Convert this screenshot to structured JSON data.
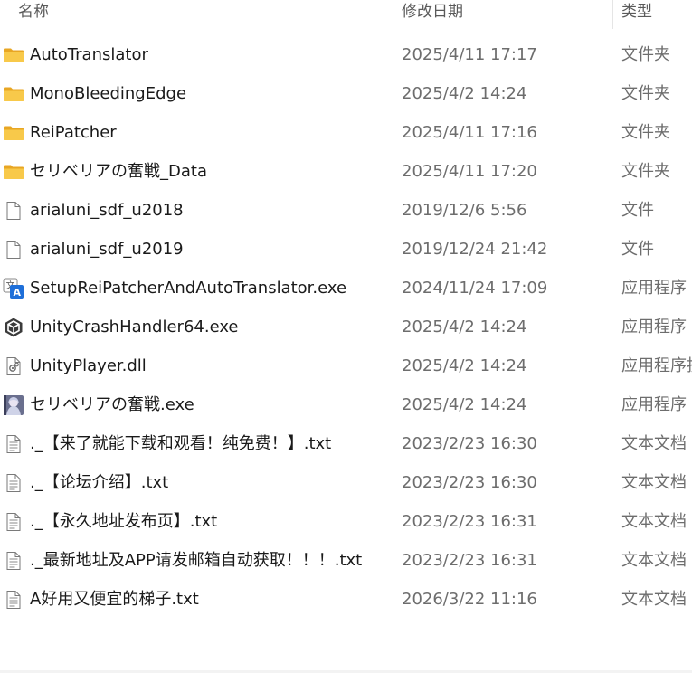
{
  "columns": {
    "name": "名称",
    "date": "修改日期",
    "type": "类型"
  },
  "files": [
    {
      "name": "AutoTranslator",
      "date": "2025/4/11 17:17",
      "type": "文件夹",
      "icon": "folder-icon"
    },
    {
      "name": "MonoBleedingEdge",
      "date": "2025/4/2 14:24",
      "type": "文件夹",
      "icon": "folder-icon"
    },
    {
      "name": "ReiPatcher",
      "date": "2025/4/11 17:16",
      "type": "文件夹",
      "icon": "folder-icon"
    },
    {
      "name": "セリベリアの奮戦_Data",
      "date": "2025/4/11 17:20",
      "type": "文件夹",
      "icon": "folder-icon"
    },
    {
      "name": "arialuni_sdf_u2018",
      "date": "2019/12/6 5:56",
      "type": "文件",
      "icon": "blank-file-icon"
    },
    {
      "name": "arialuni_sdf_u2019",
      "date": "2019/12/24 21:42",
      "type": "文件",
      "icon": "blank-file-icon"
    },
    {
      "name": "SetupReiPatcherAndAutoTranslator.exe",
      "date": "2024/11/24 17:09",
      "type": "应用程序",
      "icon": "translator-app-icon"
    },
    {
      "name": "UnityCrashHandler64.exe",
      "date": "2025/4/2 14:24",
      "type": "应用程序",
      "icon": "unity-icon"
    },
    {
      "name": "UnityPlayer.dll",
      "date": "2025/4/2 14:24",
      "type": "应用程序扩",
      "icon": "dll-file-icon"
    },
    {
      "name": "セリベリアの奮戦.exe",
      "date": "2025/4/2 14:24",
      "type": "应用程序",
      "icon": "game-app-icon"
    },
    {
      "name": "._【来了就能下载和观看！纯免费！】.txt",
      "date": "2023/2/23 16:30",
      "type": "文本文档",
      "icon": "text-file-icon"
    },
    {
      "name": "._【论坛介绍】.txt",
      "date": "2023/2/23 16:30",
      "type": "文本文档",
      "icon": "text-file-icon"
    },
    {
      "name": "._【永久地址发布页】.txt",
      "date": "2023/2/23 16:31",
      "type": "文本文档",
      "icon": "text-file-icon"
    },
    {
      "name": "._最新地址及APP请发邮箱自动获取！！！.txt",
      "date": "2023/2/23 16:31",
      "type": "文本文档",
      "icon": "text-file-icon"
    },
    {
      "name": "A好用又便宜的梯子.txt",
      "date": "2026/3/22 11:16",
      "type": "文本文档",
      "icon": "text-file-icon"
    }
  ],
  "colors": {
    "folder": "#f8c94a",
    "folder_dark": "#e8a623",
    "text_primary": "#1a1a1a",
    "text_secondary": "#6d6d6d"
  }
}
